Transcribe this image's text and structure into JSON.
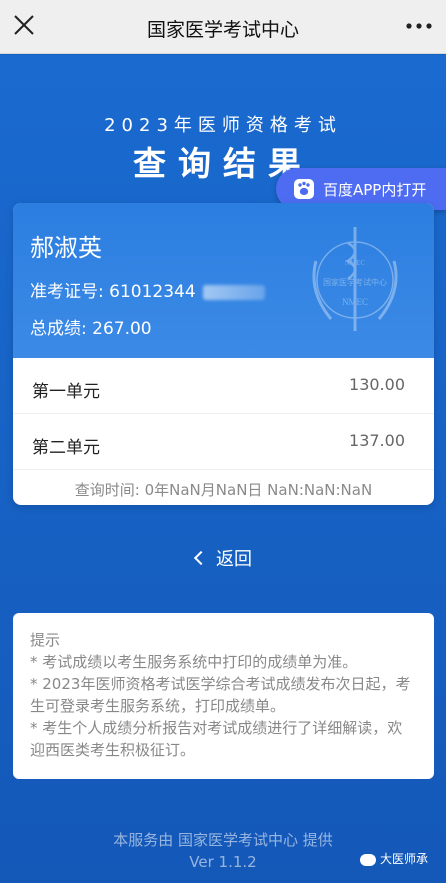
{
  "app": {
    "title": "国家医学考试中心"
  },
  "header": {
    "year_title": "2023年医师资格考试",
    "result_title": "查询结果"
  },
  "baidu_button": {
    "label": "百度APP内打开"
  },
  "candidate": {
    "name": "郝淑英",
    "exam_no_label": "准考证号:",
    "exam_no_value": "61012344",
    "total_label": "总成绩:",
    "total_value": "267.00"
  },
  "units": [
    {
      "label": "第一单元",
      "score": "130.00"
    },
    {
      "label": "第二单元",
      "score": "137.00"
    }
  ],
  "query_time": "查询时间: 0年NaN月NaN日 NaN:NaN:NaN",
  "back_label": "返回",
  "tips": {
    "title": "提示",
    "lines": [
      "* 考试成绩以考生服务系统中打印的成绩单为准。",
      "* 2023年医师资格考试医学综合考试成绩发布次日起，考生可登录考生服务系统，打印成绩单。",
      "* 考生个人成绩分析报告对考试成绩进行了详细解读，欢迎西医类考生积极征订。"
    ]
  },
  "footer": {
    "line1": "本服务由 国家医学考试中心 提供",
    "version": "Ver 1.1.2"
  },
  "watermark": "大医师承",
  "emblem_text": {
    "top": "NMEC",
    "mid": "国家医学考试中心",
    "bottom": "NMEC"
  }
}
